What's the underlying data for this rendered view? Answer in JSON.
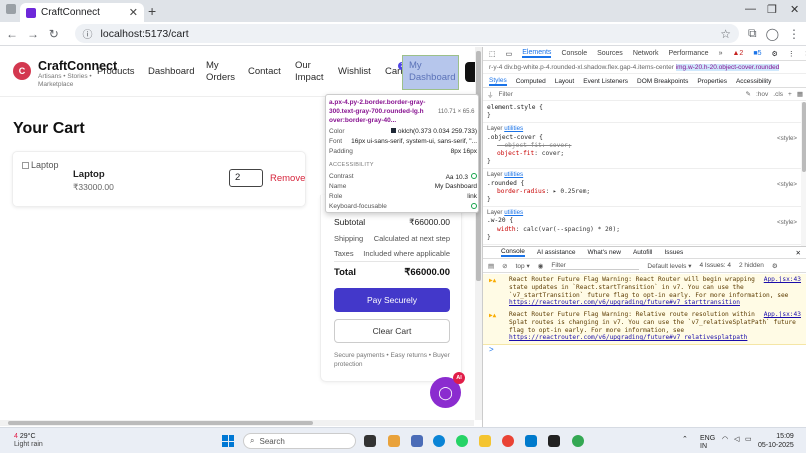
{
  "browser": {
    "tab_title": "CraftConnect",
    "url": "localhost:5173/cart"
  },
  "site": {
    "brand": "CraftConnect",
    "tagline": "Artisans • Stories • Marketplace",
    "nav": {
      "products": "Products",
      "dashboard": "Dashboard",
      "my_orders": "My Orders",
      "contact": "Contact",
      "our_impact": "Our Impact",
      "wishlist": "Wishlist",
      "cart": "Cart",
      "my_dashboard": "My Dashboard"
    },
    "cart_count": "2"
  },
  "cart": {
    "title": "Your Cart",
    "item": {
      "image_alt": "Laptop",
      "name": "Laptop",
      "price": "₹33000.00",
      "quantity": "2",
      "remove_label": "Remove"
    },
    "summary": {
      "subtotal_label": "Subtotal",
      "subtotal_value": "₹66000.00",
      "shipping_label": "Shipping",
      "shipping_value": "Calculated at next step",
      "taxes_label": "Taxes",
      "taxes_value": "Included where applicable",
      "total_label": "Total",
      "total_value": "₹66000.00",
      "pay_button": "Pay Securely",
      "clear_button": "Clear Cart",
      "security_note": "Secure payments • Easy returns • Buyer protection"
    },
    "chat_badge": "AI"
  },
  "tooltip": {
    "selector": "a.px-4.py-2.border.border-gray-300.text-gray-700.rounded-lg.h over:border-gray-40...",
    "size": "110.71 × 65.6",
    "color_label": "Color",
    "color_value": "oklch(0.373 0.034 259.733)",
    "font_label": "Font",
    "font_value": "16px ui-sans-serif, system-ui, sans-serif, \"...",
    "padding_label": "Padding",
    "padding_value": "8px 16px",
    "accessibility_heading": "ACCESSIBILITY",
    "contrast_label": "Contrast",
    "contrast_value": "Aa 10.3",
    "name_label": "Name",
    "name_value": "My Dashboard",
    "role_label": "Role",
    "role_value": "link",
    "keyboard_label": "Keyboard-focusable"
  },
  "devtools": {
    "tabs": [
      "Elements",
      "Console",
      "Sources",
      "Network",
      "Performance",
      "»"
    ],
    "warnings_count": "2",
    "issues_count": "5",
    "crumbs_left": "r-y-4",
    "crumbs_mid": "div.bg-white.p-4.rounded-xl.shadow.flex.gap-4.items-center",
    "crumbs_right": "img.w-20.h-20.object-cover.rounded",
    "subtabs": [
      "Styles",
      "Computed",
      "Layout",
      "Event Listeners",
      "DOM Breakpoints",
      "Properties",
      "Accessibility"
    ],
    "filter_placeholder": "Filter",
    "hov": ":hov",
    "cls": ".cls",
    "styles": {
      "element_style": "element.style {",
      "close_brace": "}",
      "layer_label": "Layer",
      "layer_link": "utilities",
      "origin": "<style>",
      "rule1_selector": ".object-cover {",
      "rule1_struck": "--object-fit: cover;",
      "rule1_prop": "object-fit",
      "rule1_val": "cover;",
      "rule2_selector": ".rounded {",
      "rule2_prop": "border-radius",
      "rule2_val": "0.25rem;",
      "rule3_selector": ".w-20 {",
      "rule3_prop": "width",
      "rule3_val": "calc(var(--spacing) * 20);"
    },
    "drawer_tabs": [
      "Console",
      "AI assistance",
      "What's new",
      "Autofill",
      "Issues"
    ],
    "console_context": "top",
    "console_filter": "Filter",
    "levels": "Default levels",
    "issues_label": "4 Issues: 4",
    "hidden": "2 hidden",
    "warnings": [
      {
        "text": "React Router Future Flag Warning: React Router will begin wrapping state updates in `React.startTransition` in v7. You can use the `v7_startTransition` future flag to opt-in early. For more information, see",
        "link": "https://reactrouter.com/v6/upgrading/future#v7_starttransition",
        "source": "App.jsx:43"
      },
      {
        "text": "React Router Future Flag Warning: Relative route resolution within Splat routes is changing in v7. You can use the `v7_relativeSplatPath` future flag to opt-in early. For more information, see",
        "link": "https://reactrouter.com/v6/upgrading/future#v7_relativesplatpath",
        "source": "App.jsx:43"
      }
    ],
    "prompt": ">"
  },
  "taskbar": {
    "weather_badge": "4",
    "temperature": "29°C",
    "weather": "Light rain",
    "search_placeholder": "Search",
    "lang": "ENG",
    "region": "IN",
    "time": "15:09",
    "date": "05-10-2025"
  }
}
